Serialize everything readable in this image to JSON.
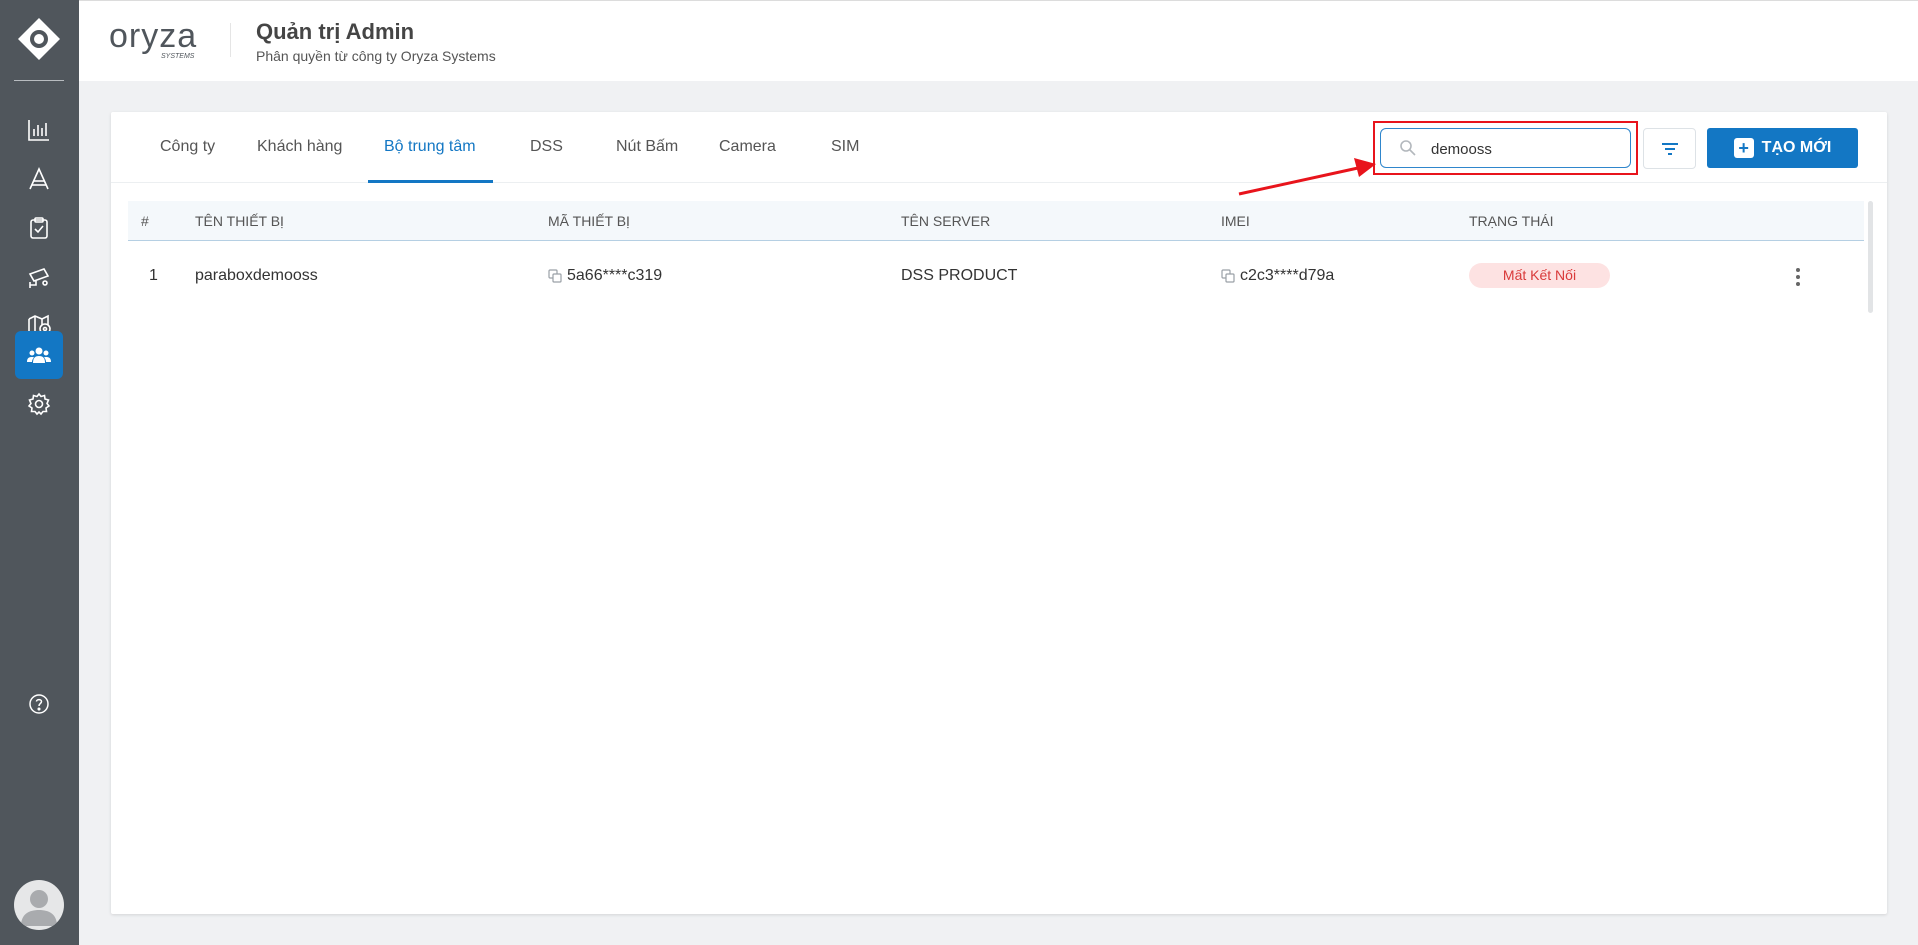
{
  "header": {
    "brand": "oryza",
    "brand_sub": "SYSTEMS",
    "title": "Quản trị Admin",
    "subtitle": "Phân quyền từ công ty Oryza Systems"
  },
  "sidebar": {
    "items": [
      {
        "icon": "bar-chart-icon"
      },
      {
        "icon": "triangle-a-icon"
      },
      {
        "icon": "clipboard-icon"
      },
      {
        "icon": "cctv-camera-icon"
      },
      {
        "icon": "map-pin-icon"
      },
      {
        "icon": "users-icon",
        "active": true
      },
      {
        "icon": "gear-icon"
      }
    ],
    "help_icon": "help-icon"
  },
  "tabs": [
    {
      "label": "Công ty"
    },
    {
      "label": "Khách hàng"
    },
    {
      "label": "Bộ trung tâm",
      "active": true
    },
    {
      "label": "DSS"
    },
    {
      "label": "Nút Bấm"
    },
    {
      "label": "Camera"
    },
    {
      "label": "SIM"
    }
  ],
  "search": {
    "value": "demooss"
  },
  "create_label": "TẠO MỚI",
  "table": {
    "columns": [
      "#",
      "TÊN THIẾT BỊ",
      "MÃ THIẾT BỊ",
      "TÊN SERVER",
      "IMEI",
      "TRẠNG THÁI"
    ],
    "rows": [
      {
        "index": "1",
        "device_name": "paraboxdemooss",
        "device_code": "5a66****c319",
        "server_name": "DSS PRODUCT",
        "imei": "c2c3****d79a",
        "status": "Mất Kết Nối"
      }
    ]
  },
  "colors": {
    "sidebar": "#50565c",
    "accent": "#1377c4",
    "highlight": "#e8141c",
    "status_bg": "#fde2e2",
    "status_text": "#d93a3a"
  }
}
